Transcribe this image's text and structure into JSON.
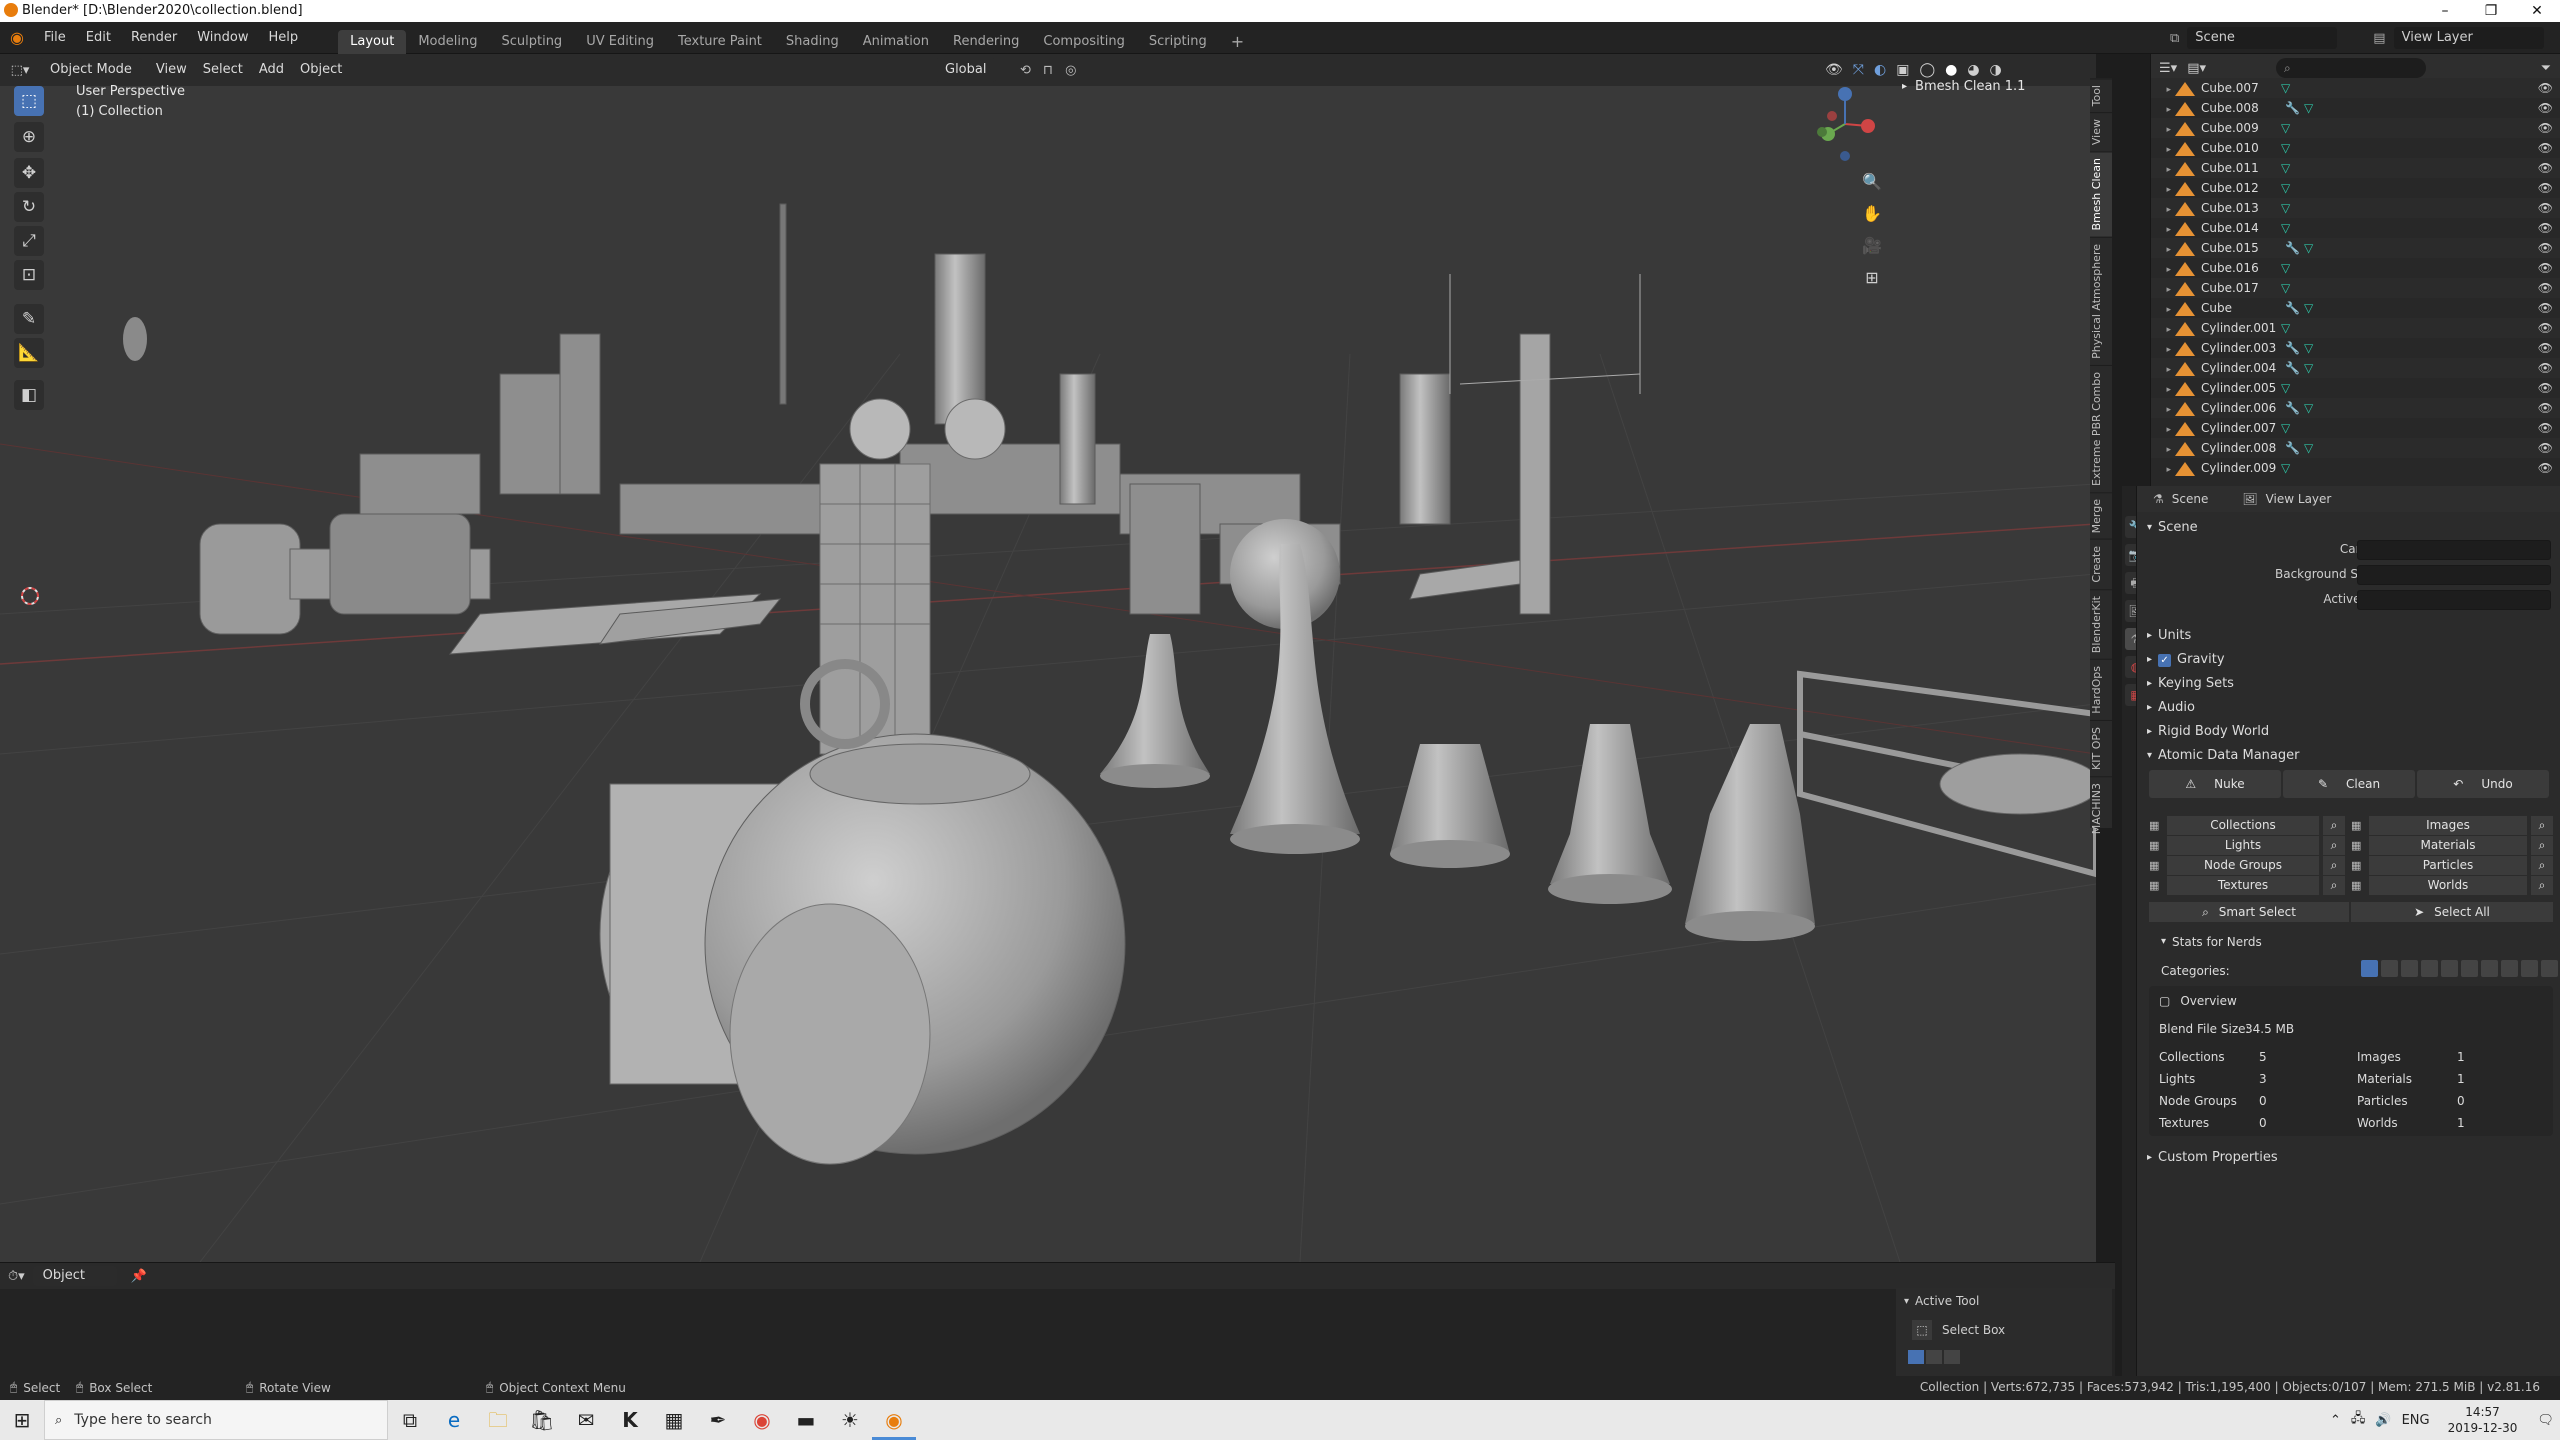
{
  "window": {
    "title": "Blender* [D:\\Blender2020\\collection.blend]"
  },
  "menu": {
    "items": [
      "File",
      "Edit",
      "Render",
      "Window",
      "Help"
    ],
    "workspaces": [
      "Layout",
      "Modeling",
      "Sculpting",
      "UV Editing",
      "Texture Paint",
      "Shading",
      "Animation",
      "Rendering",
      "Compositing",
      "Scripting"
    ],
    "active_workspace": "Layout",
    "scene": "Scene",
    "view_layer": "View Layer"
  },
  "viewport": {
    "mode": "Object Mode",
    "menus": [
      "View",
      "Select",
      "Add",
      "Object"
    ],
    "orientation": "Global",
    "perspective_label": "User Perspective",
    "collection_label": "(1) Collection",
    "addon_panel": "Bmesh Clean 1.1",
    "side_tabs": [
      "Tool",
      "View",
      "Bmesh Clean",
      "Physical Atmosphere",
      "Extreme PBR Combo",
      "Merge",
      "Create",
      "BlenderKit",
      "HardOps",
      "KIT OPS",
      "MACHIN3"
    ]
  },
  "outliner": {
    "rows": [
      {
        "name": "Cube.007",
        "mod": false
      },
      {
        "name": "Cube.008",
        "mod": true
      },
      {
        "name": "Cube.009",
        "mod": false
      },
      {
        "name": "Cube.010",
        "mod": false
      },
      {
        "name": "Cube.011",
        "mod": false
      },
      {
        "name": "Cube.012",
        "mod": false
      },
      {
        "name": "Cube.013",
        "mod": false
      },
      {
        "name": "Cube.014",
        "mod": false
      },
      {
        "name": "Cube.015",
        "mod": true
      },
      {
        "name": "Cube.016",
        "mod": false
      },
      {
        "name": "Cube.017",
        "mod": false
      },
      {
        "name": "Cube",
        "mod": true
      },
      {
        "name": "Cylinder.001",
        "mod": false
      },
      {
        "name": "Cylinder.003",
        "mod": true
      },
      {
        "name": "Cylinder.004",
        "mod": true
      },
      {
        "name": "Cylinder.005",
        "mod": false
      },
      {
        "name": "Cylinder.006",
        "mod": true
      },
      {
        "name": "Cylinder.007",
        "mod": false
      },
      {
        "name": "Cylinder.008",
        "mod": true
      },
      {
        "name": "Cylinder.009",
        "mod": false
      }
    ]
  },
  "properties": {
    "breadcrumb_scene": "Scene",
    "breadcrumb_layer": "View Layer",
    "scene_section": "Scene",
    "camera_label": "Camera",
    "bg_scene_label": "Background Scene",
    "active_clip_label": "Active Clip",
    "units": "Units",
    "gravity": "Gravity",
    "keying_sets": "Keying Sets",
    "audio": "Audio",
    "rigid_body": "Rigid Body World",
    "atomic": "Atomic Data Manager",
    "nuke": "Nuke",
    "clean": "Clean",
    "undo": "Undo",
    "left_list": [
      "Collections",
      "Lights",
      "Node Groups",
      "Textures"
    ],
    "right_list": [
      "Images",
      "Materials",
      "Particles",
      "Worlds"
    ],
    "smart_select": "Smart Select",
    "select_all": "Select All",
    "stats_for_nerds": "Stats for Nerds",
    "categories": "Categories:",
    "overview": "Overview",
    "blend_file_size_label": "Blend File Size:",
    "blend_file_size": "34.5 MB",
    "stats_left": [
      {
        "k": "Collections",
        "v": "5"
      },
      {
        "k": "Lights",
        "v": "3"
      },
      {
        "k": "Node Groups",
        "v": "0"
      },
      {
        "k": "Textures",
        "v": "0"
      }
    ],
    "stats_right": [
      {
        "k": "Images",
        "v": "1"
      },
      {
        "k": "Materials",
        "v": "1"
      },
      {
        "k": "Particles",
        "v": "0"
      },
      {
        "k": "Worlds",
        "v": "1"
      }
    ],
    "custom_props": "Custom Properties"
  },
  "timeline": {
    "mode": "Object",
    "active_tool_header": "Active Tool",
    "active_tool_name": "Select Box"
  },
  "status": {
    "select": "Select",
    "box_select": "Box Select",
    "rotate_view": "Rotate View",
    "context_menu": "Object Context Menu",
    "stats": "Collection | Verts:672,735 | Faces:573,942 | Tris:1,195,400 | Objects:0/107 | Mem: 271.5 MiB | v2.81.16"
  },
  "taskbar": {
    "search_placeholder": "Type here to search",
    "lang": "ENG",
    "time": "14:57",
    "date": "2019-12-30"
  },
  "colors": {
    "accent": "#4772b3",
    "object_orange": "#e69234",
    "mesh_green": "#2ec3a4"
  }
}
